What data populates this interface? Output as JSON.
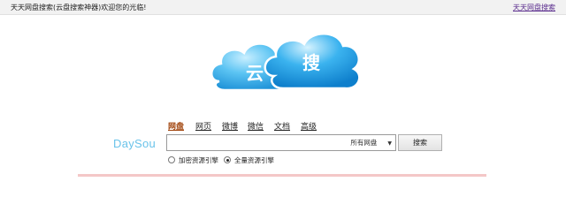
{
  "topbar": {
    "welcome_text": "天天网盘搜索(云盘搜索神器)欢迎您的光临!",
    "right_link": "天天网盘搜索"
  },
  "logo": {
    "char_left": "云",
    "char_right": "搜",
    "colors": {
      "cloud_light": "#7fd1f6",
      "cloud_main": "#2aa9ea",
      "cloud_dark": "#1488cf",
      "outline": "#ffffff"
    }
  },
  "tabs": [
    {
      "label": "网盘",
      "active": true
    },
    {
      "label": "网页",
      "active": false
    },
    {
      "label": "微博",
      "active": false
    },
    {
      "label": "微信",
      "active": false
    },
    {
      "label": "文档",
      "active": false
    },
    {
      "label": "高级",
      "active": false
    }
  ],
  "brand": "DaySou",
  "search": {
    "value": "",
    "scope_selected": "所有网盘",
    "button_label": "搜索"
  },
  "engine_options": [
    {
      "label": "加密资源引擎",
      "checked": false
    },
    {
      "label": "全量资源引擎",
      "checked": true
    }
  ],
  "colors": {
    "active_tab": "#a0420a",
    "brand": "#6ac3ea",
    "link_visited": "#5b2d8e"
  }
}
